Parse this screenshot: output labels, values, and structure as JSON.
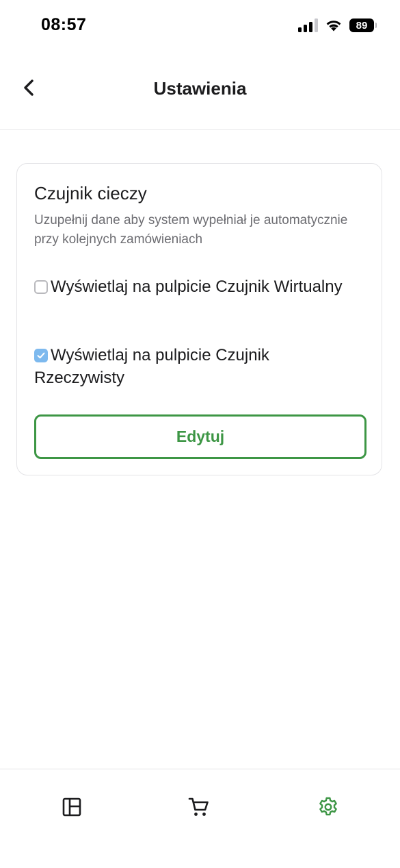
{
  "status_bar": {
    "time": "08:57",
    "battery": "89"
  },
  "header": {
    "title": "Ustawienia"
  },
  "card": {
    "title": "Czujnik cieczy",
    "description": "Uzupełnij dane aby system wypełniał je automatycznie przy kolejnych zamówieniach",
    "options": [
      {
        "label": "Wyświetlaj na pulpicie Czujnik Wirtualny",
        "checked": false
      },
      {
        "label": "Wyświetlaj na pulpicie Czujnik Rzeczywisty",
        "checked": true
      }
    ],
    "edit_button_label": "Edytuj"
  },
  "bottom_nav": {
    "items": [
      {
        "icon": "dashboard-icon",
        "active": false
      },
      {
        "icon": "cart-icon",
        "active": false
      },
      {
        "icon": "gear-icon",
        "active": true
      }
    ]
  },
  "colors": {
    "accent_green": "#3d9645",
    "checkbox_checked": "#7db9ee",
    "icon_default": "#1c1c1e"
  }
}
